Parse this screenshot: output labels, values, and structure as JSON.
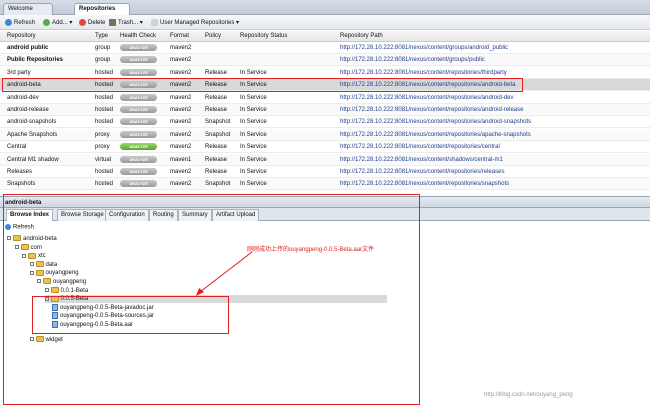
{
  "tabs": [
    {
      "label": "Welcome"
    },
    {
      "label": "Repositories"
    }
  ],
  "toolbar": {
    "refresh": "Refresh",
    "add": "Add...",
    "delete": "Delete",
    "trash": "Trash...",
    "user_managed": "User Managed Repositories"
  },
  "table": {
    "columns": [
      "Repository",
      "Type",
      "Health Check",
      "Format",
      "Policy",
      "Repository Status",
      "Repository Path"
    ],
    "rows": [
      {
        "name": "android public",
        "type": "group",
        "health": "ANALYZE",
        "format": "maven2",
        "policy": "",
        "status": "",
        "path": "http://172.28.10.222:8081/nexus/content/groups/android_public",
        "bold": true
      },
      {
        "name": "Public Repositories",
        "type": "group",
        "health": "ANALYZE",
        "format": "maven2",
        "policy": "",
        "status": "",
        "path": "http://172.28.10.222:8081/nexus/content/groups/public",
        "bold": true
      },
      {
        "name": "3rd party",
        "type": "hosted",
        "health": "ANALYZE",
        "format": "maven2",
        "policy": "Release",
        "status": "In Service",
        "path": "http://172.28.10.222:8081/nexus/content/repositories/thirdparty"
      },
      {
        "name": "android-beta",
        "type": "hosted",
        "health": "ANALYZE",
        "format": "maven2",
        "policy": "Release",
        "status": "In Service",
        "path": "http://172.28.10.222:8081/nexus/content/repositories/android-beta",
        "selected": true
      },
      {
        "name": "android-dev",
        "type": "hosted",
        "health": "ANALYZE",
        "format": "maven2",
        "policy": "Release",
        "status": "In Service",
        "path": "http://172.28.10.222:8081/nexus/content/repositories/android-dev"
      },
      {
        "name": "android-release",
        "type": "hosted",
        "health": "ANALYZE",
        "format": "maven2",
        "policy": "Release",
        "status": "In Service",
        "path": "http://172.28.10.222:8081/nexus/content/repositories/android-release"
      },
      {
        "name": "android-snapshots",
        "type": "hosted",
        "health": "ANALYZE",
        "format": "maven2",
        "policy": "Snapshot",
        "status": "In Service",
        "path": "http://172.28.10.222:8081/nexus/content/repositories/android-snapshots"
      },
      {
        "name": "Apache Snapshots",
        "type": "proxy",
        "health": "ANALYZE",
        "format": "maven2",
        "policy": "Snapshot",
        "status": "In Service",
        "path": "http://172.28.10.222:8081/nexus/content/repositories/apache-snapshots"
      },
      {
        "name": "Central",
        "type": "proxy",
        "health": "ANALYZE",
        "format": "maven2",
        "policy": "Release",
        "status": "In Service",
        "path": "http://172.28.10.222:8081/nexus/content/repositories/central",
        "green": true
      },
      {
        "name": "Central M1 shadow",
        "type": "virtual",
        "health": "ANALYZE",
        "format": "maven1",
        "policy": "Release",
        "status": "In Service",
        "path": "http://172.28.10.222:8081/nexus/content/shadows/central-m1"
      },
      {
        "name": "Releases",
        "type": "hosted",
        "health": "ANALYZE",
        "format": "maven2",
        "policy": "Release",
        "status": "In Service",
        "path": "http://172.28.10.222:8081/nexus/content/repositories/releases"
      },
      {
        "name": "Snapshots",
        "type": "hosted",
        "health": "ANALYZE",
        "format": "maven2",
        "policy": "Snapshot",
        "status": "In Service",
        "path": "http://172.28.10.222:8081/nexus/content/repositories/snapshots"
      }
    ]
  },
  "detail": {
    "title": "android-beta",
    "tabs": [
      "Browse Index",
      "Browse Storage",
      "Configuration",
      "Routing",
      "Summary",
      "Artifact Upload"
    ],
    "refresh": "Refresh",
    "tree": [
      {
        "label": "android-beta",
        "depth": 0,
        "kind": "folder"
      },
      {
        "label": "com",
        "depth": 1,
        "kind": "folder"
      },
      {
        "label": "xtc",
        "depth": 2,
        "kind": "folder"
      },
      {
        "label": "data",
        "depth": 3,
        "kind": "folder"
      },
      {
        "label": "ouyangpeng",
        "depth": 3,
        "kind": "folder"
      },
      {
        "label": "ouyangpeng",
        "depth": 4,
        "kind": "folder"
      },
      {
        "label": "0.0.1-Beta",
        "depth": 5,
        "kind": "folder"
      },
      {
        "label": "0.0.5-Beta",
        "depth": 5,
        "kind": "folder",
        "selected": true
      },
      {
        "label": "ouyangpeng-0.0.5-Beta-javadoc.jar",
        "depth": 6,
        "kind": "file"
      },
      {
        "label": "ouyangpeng-0.0.5-Beta-sources.jar",
        "depth": 6,
        "kind": "file"
      },
      {
        "label": "ouyangpeng-0.0.5-Beta.aar",
        "depth": 6,
        "kind": "file"
      },
      {
        "label": "widget",
        "depth": 3,
        "kind": "folder"
      }
    ]
  },
  "annotation": "刚刚成功上传的ouyangpeng-0.0.5-Beta.aar文件",
  "watermark": "http://blog.csdn.net/ouyang_peng",
  "colors": {
    "highlight": "#e02020",
    "analyze_gray": "#a8a8a8",
    "analyze_green": "#5aa52a",
    "link": "#1f3d8b"
  }
}
